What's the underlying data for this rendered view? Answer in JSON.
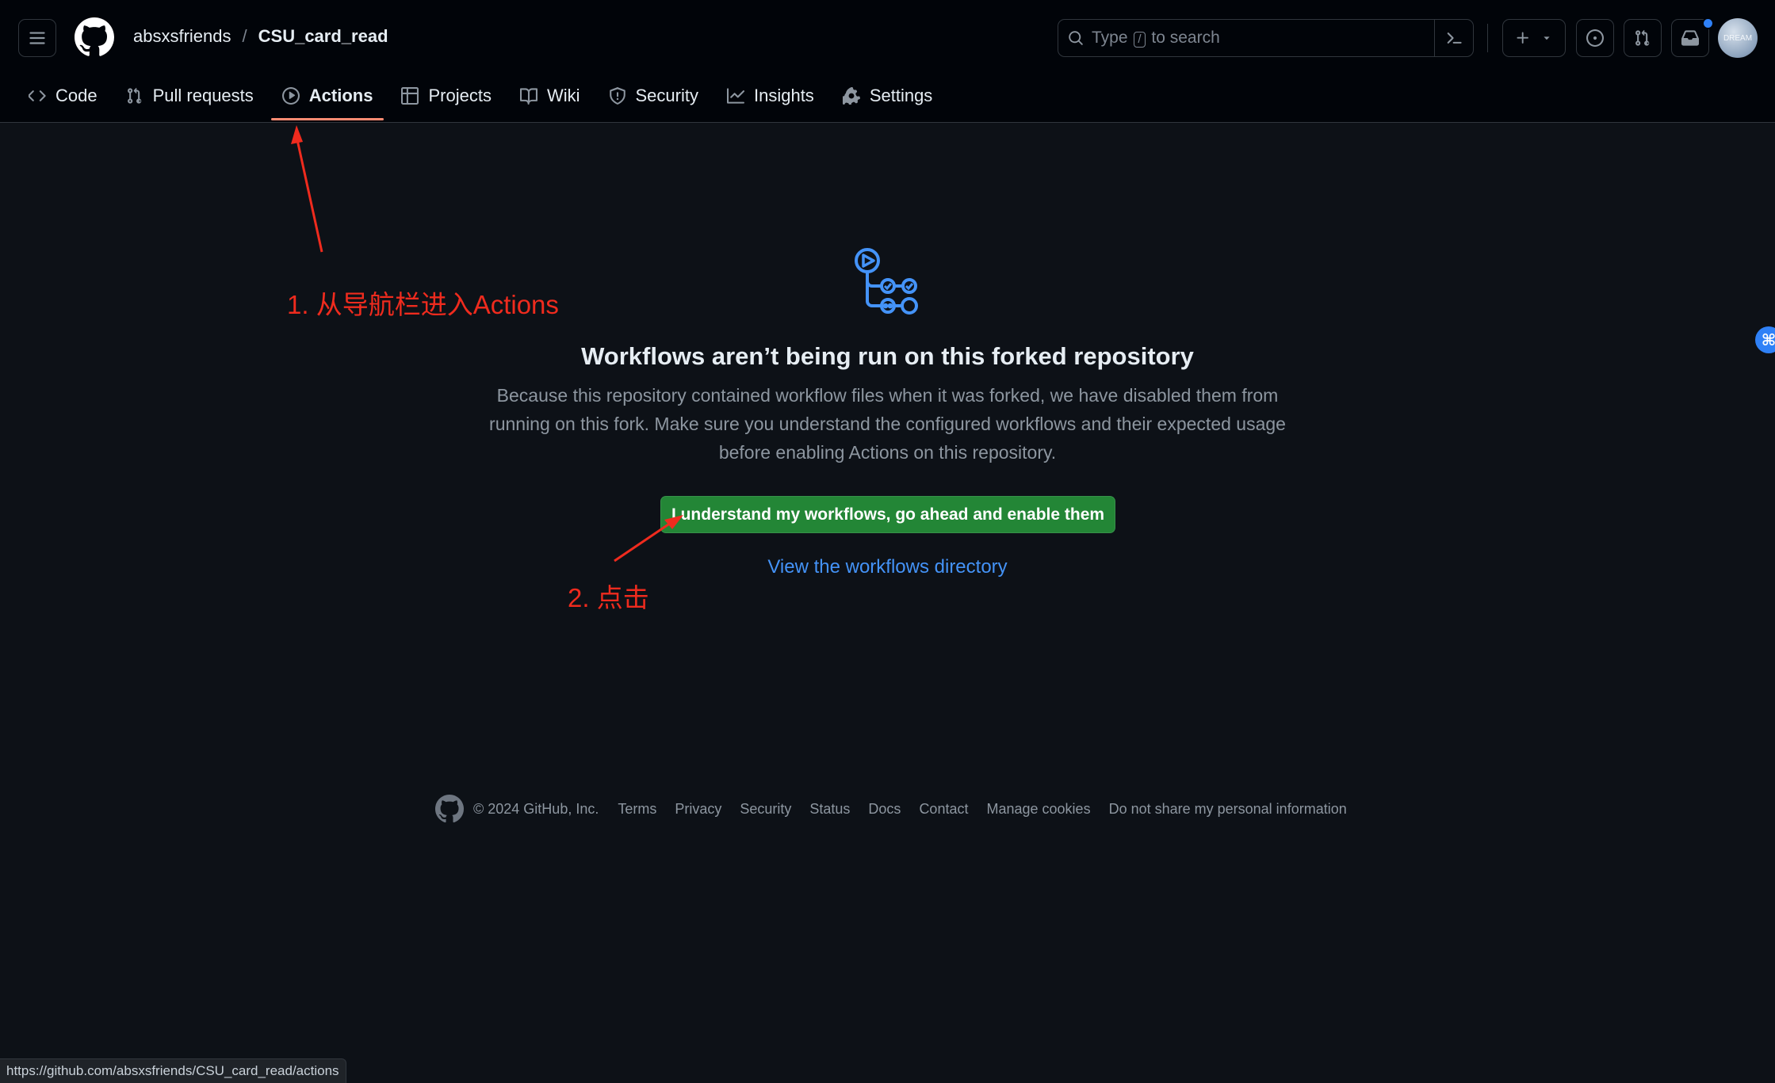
{
  "header": {
    "owner": "absxsfriends",
    "separator": "/",
    "repo": "CSU_card_read",
    "search": {
      "prefix": "Type",
      "slash": "/",
      "suffix": "to search"
    },
    "avatar_text": "DREAM"
  },
  "nav": {
    "tabs": [
      {
        "label": "Code",
        "icon": "code-icon"
      },
      {
        "label": "Pull requests",
        "icon": "pull-request-icon"
      },
      {
        "label": "Actions",
        "icon": "play-icon",
        "active": true
      },
      {
        "label": "Projects",
        "icon": "table-icon"
      },
      {
        "label": "Wiki",
        "icon": "book-icon"
      },
      {
        "label": "Security",
        "icon": "shield-icon"
      },
      {
        "label": "Insights",
        "icon": "graph-icon"
      },
      {
        "label": "Settings",
        "icon": "gear-icon"
      }
    ]
  },
  "main": {
    "title": "Workflows aren’t being run on this forked repository",
    "description": "Because this repository contained workflow files when it was forked, we have disabled them from running on this fork. Make sure you understand the configured workflows and their expected usage before enabling Actions on this repository.",
    "enable_button": "I understand my workflows, go ahead and enable them",
    "view_link": "View the workflows directory"
  },
  "annotations": {
    "step1": "1. 从导航栏进入Actions",
    "step2": "2. 点击",
    "color": "#ef2b1e"
  },
  "footer": {
    "copyright": "© 2024 GitHub, Inc.",
    "links": [
      "Terms",
      "Privacy",
      "Security",
      "Status",
      "Docs",
      "Contact",
      "Manage cookies",
      "Do not share my personal information"
    ]
  },
  "status_bar": {
    "url": "https://github.com/absxsfriends/CSU_card_read/actions"
  },
  "colors": {
    "accent_green": "#238636",
    "link_blue": "#4493f8",
    "tab_underline": "#fd8c73",
    "background": "#0d1117"
  }
}
